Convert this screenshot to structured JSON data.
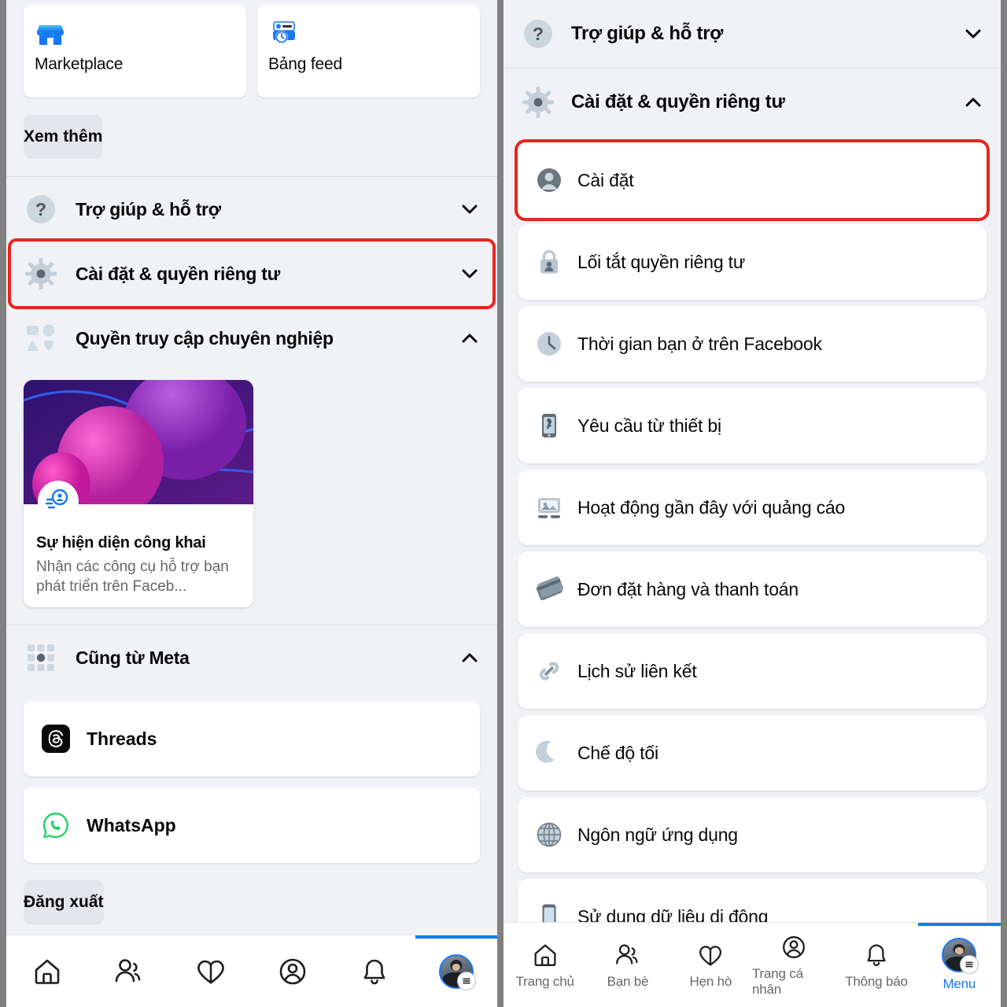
{
  "left_panel": {
    "shortcuts": [
      {
        "label": "Marketplace",
        "icon": "marketplace-storefront-icon"
      },
      {
        "label": "Bảng feed",
        "icon": "feeds-clock-icon"
      }
    ],
    "see_more_label": "Xem thêm",
    "accordions": [
      {
        "label": "Trợ giúp & hỗ trợ",
        "icon": "question-mark-circle-icon",
        "state": "collapsed",
        "highlighted": false
      },
      {
        "label": "Cài đặt & quyền riêng tư",
        "icon": "gear-icon",
        "state": "collapsed",
        "highlighted": true
      },
      {
        "label": "Quyền truy cập chuyên nghiệp",
        "icon": "professional-group-icon",
        "state": "expanded",
        "highlighted": false
      }
    ],
    "promo_card": {
      "badge_icon": "public-presence-icon",
      "title": "Sự hiện diện công khai",
      "subtitle": "Nhận các công cụ hỗ trợ bạn phát triển trên Faceb..."
    },
    "meta_section": {
      "label": "Cũng từ Meta",
      "icon": "meta-apps-grid-icon",
      "state": "expanded",
      "apps": [
        {
          "label": "Threads",
          "icon": "threads-icon"
        },
        {
          "label": "WhatsApp",
          "icon": "whatsapp-icon"
        }
      ]
    },
    "logout_label": "Đăng xuất"
  },
  "right_panel": {
    "accordions": [
      {
        "label": "Trợ giúp & hỗ trợ",
        "icon": "question-mark-circle-icon",
        "state": "collapsed"
      },
      {
        "label": "Cài đặt & quyền riêng tư",
        "icon": "gear-icon",
        "state": "expanded"
      }
    ],
    "items": [
      {
        "label": "Cài đặt",
        "icon": "person-circle-icon",
        "highlighted": true
      },
      {
        "label": "Lối tắt quyền riêng tư",
        "icon": "lock-person-icon",
        "highlighted": false
      },
      {
        "label": "Thời gian bạn ở trên Facebook",
        "icon": "clock-icon",
        "highlighted": false
      },
      {
        "label": "Yêu cầu từ thiết bị",
        "icon": "phone-key-icon",
        "highlighted": false
      },
      {
        "label": "Hoạt động gần đây với quảng cáo",
        "icon": "ad-activity-icon",
        "highlighted": false
      },
      {
        "label": "Đơn đặt hàng và thanh toán",
        "icon": "payment-cards-icon",
        "highlighted": false
      },
      {
        "label": "Lịch sử liên kết",
        "icon": "link-chain-icon",
        "highlighted": false
      },
      {
        "label": "Chế độ tối",
        "icon": "moon-icon",
        "highlighted": false
      },
      {
        "label": "Ngôn ngữ ứng dụng",
        "icon": "globe-icon",
        "highlighted": false
      },
      {
        "label": "Sử dụng dữ liệu di động",
        "icon": "mobile-phone-icon",
        "highlighted": false
      }
    ]
  },
  "bottom_nav": {
    "tabs": [
      {
        "label": "Trang chủ",
        "icon": "home-icon",
        "active": false
      },
      {
        "label": "Bạn bè",
        "icon": "friends-icon",
        "active": false
      },
      {
        "label": "Hẹn hò",
        "icon": "dating-heart-icon",
        "active": false
      },
      {
        "label": "Trang cá nhân",
        "icon": "profile-circle-icon",
        "active": false
      },
      {
        "label": "Thông báo",
        "icon": "bell-icon",
        "active": false
      },
      {
        "label": "Menu",
        "icon": "avatar-menu-icon",
        "active": true
      }
    ]
  },
  "colors": {
    "highlight_red": "#e8251e",
    "accent_blue": "#1877f2",
    "background": "#f0f2f5",
    "card": "#ffffff",
    "divider": "#808080"
  }
}
